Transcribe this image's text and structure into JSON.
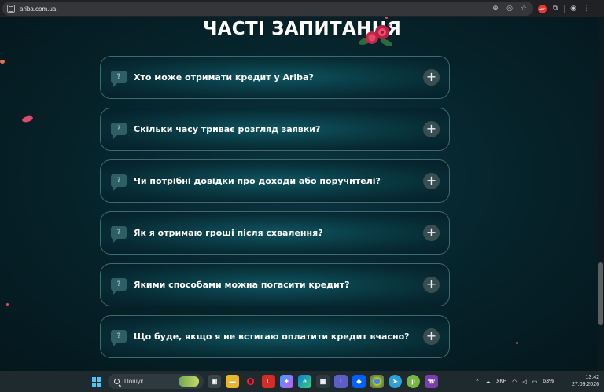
{
  "browser": {
    "url": "ariba.com.ua",
    "icons": [
      "zoom-icon",
      "eye-off-icon",
      "star-icon",
      "adblock-icon",
      "extensions-icon",
      "profile-icon",
      "menu-icon"
    ],
    "adblock_label": "ABP"
  },
  "faq": {
    "title": "ЧАСТІ ЗАПИТАННЯ",
    "q_mark": "?",
    "plus": "+",
    "items": [
      {
        "question": "Хто може отримати кредит у Ariba?"
      },
      {
        "question": "Скільки часу триває розгляд заявки?"
      },
      {
        "question": "Чи потрібні довідки про доходи або поручителі?"
      },
      {
        "question": "Як я отримаю гроші після схвалення?"
      },
      {
        "question": "Якими способами можна погасити кредит?"
      },
      {
        "question": "Що буде, якщо я не встигаю оплатити кредит вчасно?"
      }
    ]
  },
  "taskbar": {
    "search_placeholder": "Пошук",
    "language": "УКР",
    "battery": "63%",
    "time": "13:42",
    "date": "27.09.2026",
    "apps": [
      "file-explorer",
      "opera",
      "lastpass",
      "copilot",
      "edge",
      "store",
      "dropbox",
      "chrome",
      "telegram",
      "utorrent",
      "viber"
    ]
  },
  "colors": {
    "page_bg": "#061f26",
    "card_border": "#3c6b72",
    "accent_rose": "#e14b6a"
  }
}
